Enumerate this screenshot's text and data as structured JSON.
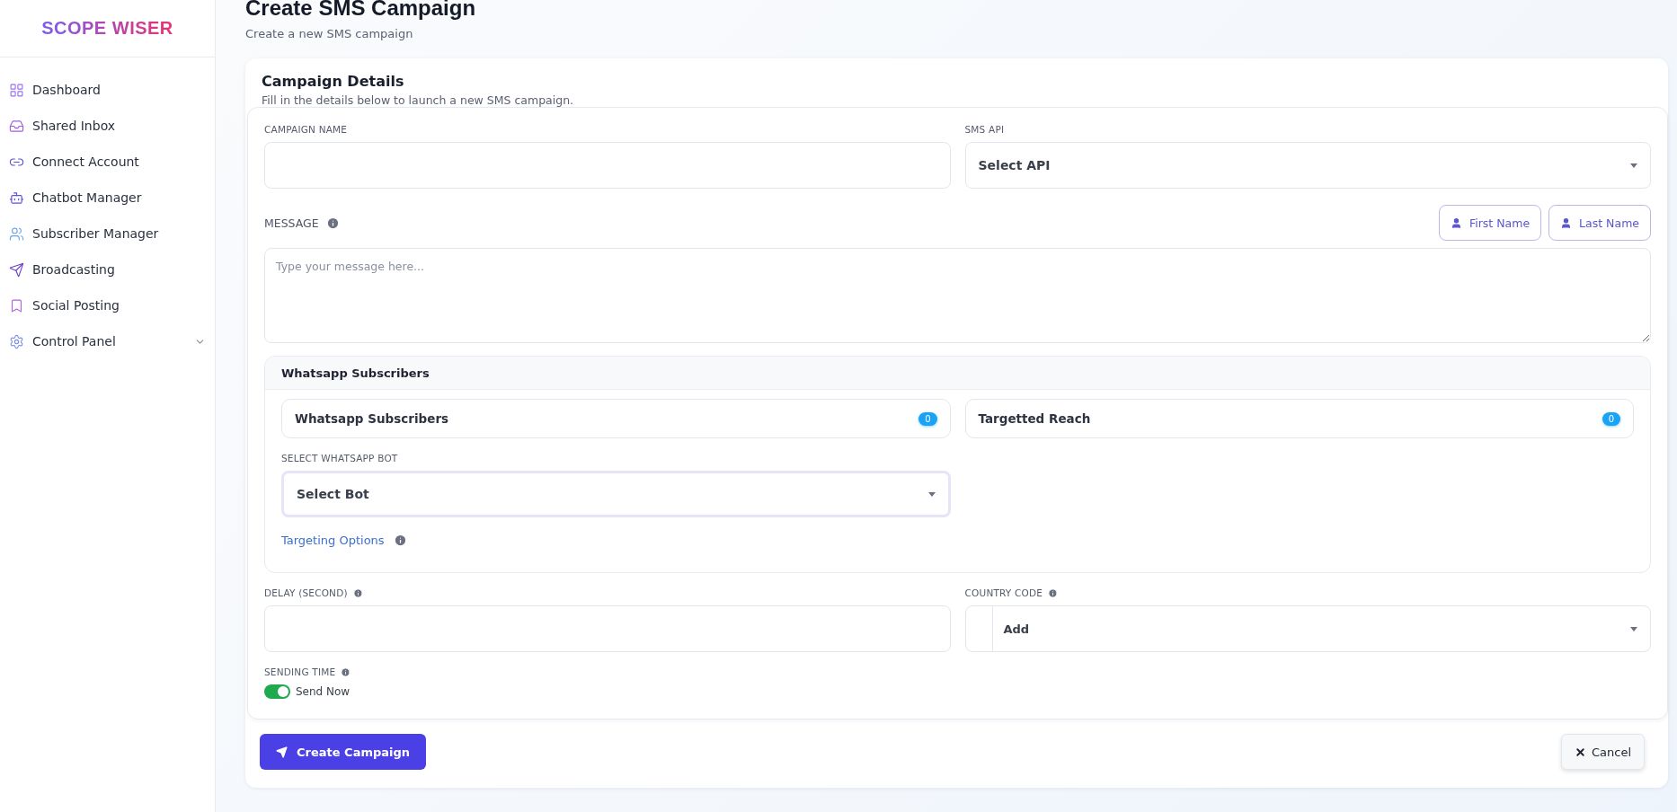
{
  "logo": {
    "text": "SCOPE WISER"
  },
  "sidebar": {
    "items": [
      {
        "label": "Dashboard",
        "selected": false,
        "expandable": false
      },
      {
        "label": "Shared Inbox",
        "selected": false,
        "expandable": false
      },
      {
        "label": "Connect Account",
        "selected": false,
        "expandable": false
      },
      {
        "label": "Chatbot Manager",
        "selected": false,
        "expandable": false
      },
      {
        "label": "Subscriber Manager",
        "selected": false,
        "expandable": false
      },
      {
        "label": "Broadcasting",
        "selected": false,
        "expandable": false
      },
      {
        "label": "Social Posting",
        "selected": false,
        "expandable": false
      },
      {
        "label": "Control Panel",
        "selected": false,
        "expandable": true
      }
    ]
  },
  "page": {
    "title": "Create SMS Campaign",
    "subtitle": "Create a new SMS campaign"
  },
  "card": {
    "title": "Campaign Details",
    "subtitle": "Fill in the details below to launch a new SMS campaign."
  },
  "form": {
    "campaign_name": {
      "label": "CAMPAIGN NAME"
    },
    "sms_api": {
      "label": "SMS API",
      "value": "Select API"
    },
    "message": {
      "label": "MESSAGE",
      "placeholder": "Type your message here...",
      "tags": [
        "First Name",
        "Last Name"
      ]
    },
    "subscribers": {
      "title": "Whatsapp Subscribers",
      "stats": [
        {
          "label": "Whatsapp Subscribers",
          "count": "0"
        },
        {
          "label": "Targetted Reach",
          "count": "0"
        }
      ],
      "bot": {
        "label": "SELECT WHATSAPP BOT",
        "value": "Select Bot"
      },
      "targeting_link": "Targeting Options"
    },
    "delay": {
      "label": "DELAY (SECOND)"
    },
    "country_code": {
      "label": "COUNTRY CODE",
      "value": "Add"
    },
    "sending_time": {
      "label": "SENDING TIME",
      "option": "Send Now",
      "on": true
    }
  },
  "buttons": {
    "submit": "Create Campaign",
    "cancel": "Cancel"
  }
}
